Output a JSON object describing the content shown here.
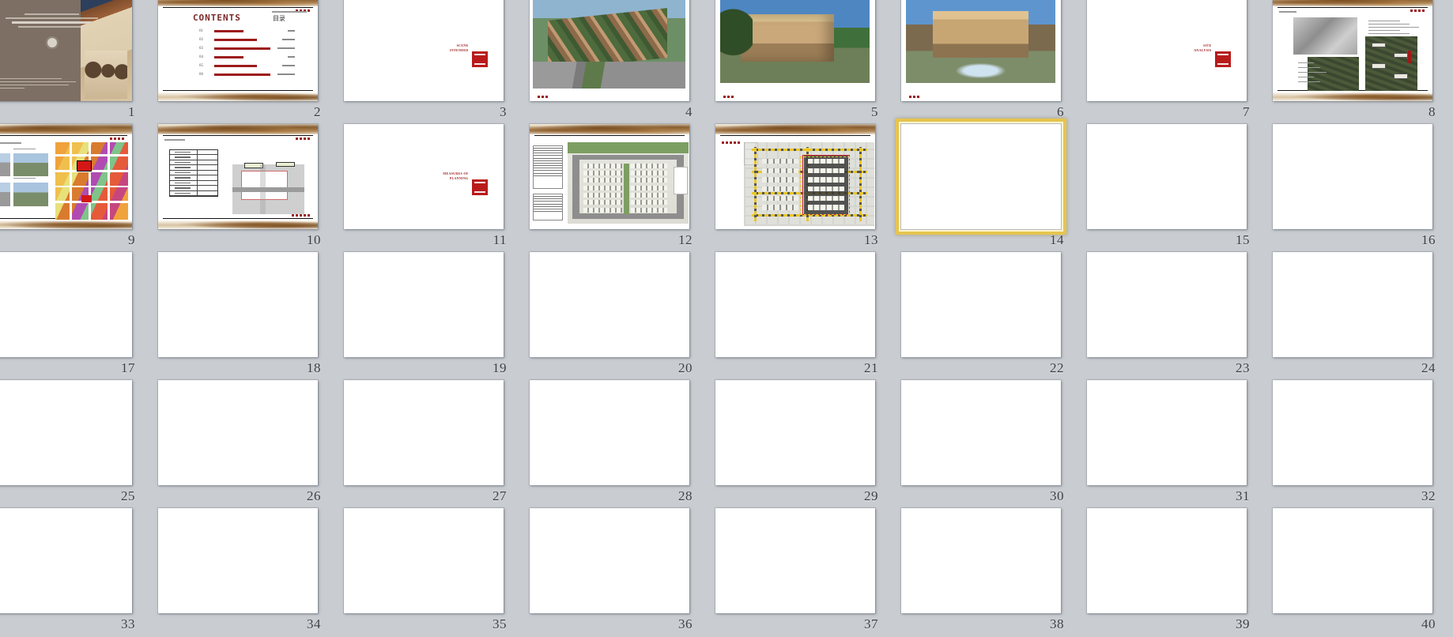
{
  "app": {
    "view_mode": "thumbnail-grid",
    "background_color": "#c9ccd1",
    "selection_color": "#e6c44f",
    "columns": 8,
    "selected_page": 14,
    "total_visible_pages": 40
  },
  "pages": [
    {
      "number": "1",
      "kind": "cover",
      "selected": false,
      "blank": false
    },
    {
      "number": "2",
      "kind": "contents",
      "selected": false,
      "blank": false
    },
    {
      "number": "3",
      "kind": "stamp",
      "selected": false,
      "blank": false
    },
    {
      "number": "4",
      "kind": "photo-aerial",
      "selected": false,
      "blank": false
    },
    {
      "number": "5",
      "kind": "photo-arch",
      "selected": false,
      "blank": false
    },
    {
      "number": "6",
      "kind": "photo-plaza",
      "selected": false,
      "blank": false
    },
    {
      "number": "7",
      "kind": "stamp",
      "selected": false,
      "blank": false
    },
    {
      "number": "8",
      "kind": "map-analysis",
      "selected": false,
      "blank": false
    },
    {
      "number": "9",
      "kind": "zoning-map",
      "selected": false,
      "blank": false
    },
    {
      "number": "10",
      "kind": "table-plot",
      "selected": false,
      "blank": false
    },
    {
      "number": "11",
      "kind": "stamp",
      "selected": false,
      "blank": false
    },
    {
      "number": "12",
      "kind": "siteplan",
      "selected": false,
      "blank": false
    },
    {
      "number": "13",
      "kind": "siteplan13",
      "selected": false,
      "blank": false
    },
    {
      "number": "14",
      "kind": "blank",
      "selected": true,
      "blank": true
    },
    {
      "number": "15",
      "kind": "blank",
      "selected": false,
      "blank": true
    },
    {
      "number": "16",
      "kind": "blank",
      "selected": false,
      "blank": true
    },
    {
      "number": "17",
      "kind": "blank",
      "selected": false,
      "blank": true
    },
    {
      "number": "18",
      "kind": "blank",
      "selected": false,
      "blank": true
    },
    {
      "number": "19",
      "kind": "blank",
      "selected": false,
      "blank": true
    },
    {
      "number": "20",
      "kind": "blank",
      "selected": false,
      "blank": true
    },
    {
      "number": "21",
      "kind": "blank",
      "selected": false,
      "blank": true
    },
    {
      "number": "22",
      "kind": "blank",
      "selected": false,
      "blank": true
    },
    {
      "number": "23",
      "kind": "blank",
      "selected": false,
      "blank": true
    },
    {
      "number": "24",
      "kind": "blank",
      "selected": false,
      "blank": true
    },
    {
      "number": "25",
      "kind": "blank",
      "selected": false,
      "blank": true
    },
    {
      "number": "26",
      "kind": "blank",
      "selected": false,
      "blank": true
    },
    {
      "number": "27",
      "kind": "blank",
      "selected": false,
      "blank": true
    },
    {
      "number": "28",
      "kind": "blank",
      "selected": false,
      "blank": true
    },
    {
      "number": "29",
      "kind": "blank",
      "selected": false,
      "blank": true
    },
    {
      "number": "30",
      "kind": "blank",
      "selected": false,
      "blank": true
    },
    {
      "number": "31",
      "kind": "blank",
      "selected": false,
      "blank": true
    },
    {
      "number": "32",
      "kind": "blank",
      "selected": false,
      "blank": true
    },
    {
      "number": "33",
      "kind": "blank",
      "selected": false,
      "blank": true
    },
    {
      "number": "34",
      "kind": "blank",
      "selected": false,
      "blank": true
    },
    {
      "number": "35",
      "kind": "blank",
      "selected": false,
      "blank": true
    },
    {
      "number": "36",
      "kind": "blank",
      "selected": false,
      "blank": true
    },
    {
      "number": "37",
      "kind": "blank",
      "selected": false,
      "blank": true
    },
    {
      "number": "38",
      "kind": "blank",
      "selected": false,
      "blank": true
    },
    {
      "number": "39",
      "kind": "blank",
      "selected": false,
      "blank": true
    },
    {
      "number": "40",
      "kind": "blank",
      "selected": false,
      "blank": true
    }
  ],
  "slide_content": {
    "cover": {
      "title_en": "SUBIC QINGTIAN LAKE",
      "panel_color": "#7d6f63"
    },
    "contents": {
      "heading": "CONTENTS",
      "heading_cn": "目录",
      "entries": [
        {
          "no": "01",
          "page_ref": "P 03"
        },
        {
          "no": "02",
          "page_ref": "P 07 - P 08"
        },
        {
          "no": "03",
          "page_ref": "P 11 - P 13"
        },
        {
          "no": "04",
          "page_ref": "P 15 - P 20"
        },
        {
          "no": "05",
          "page_ref": "P 22"
        },
        {
          "no": "06",
          "page_ref": "P 28"
        }
      ]
    },
    "stamp_slides": [
      {
        "line1": "SCENE",
        "line2": "INTENDED"
      },
      {
        "line1": "SITE",
        "line2": "ANALYSIS"
      },
      {
        "line1": "MEASURES OF",
        "line2": "PLANNING"
      }
    ]
  }
}
